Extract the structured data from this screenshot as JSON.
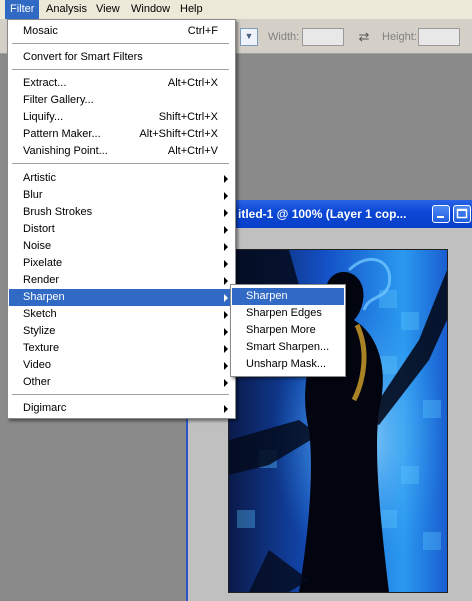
{
  "menubar": {
    "items": [
      {
        "label": "Filter"
      },
      {
        "label": "Analysis"
      },
      {
        "label": "View"
      },
      {
        "label": "Window"
      },
      {
        "label": "Help"
      }
    ]
  },
  "options_bar": {
    "width_label": "Width:",
    "height_label": "Height:",
    "width_value": "",
    "height_value": ""
  },
  "document": {
    "title": "itled-1 @ 100% (Layer 1 cop..."
  },
  "filter_menu": {
    "top_items": [
      {
        "label": "Mosaic",
        "shortcut": "Ctrl+F"
      },
      {
        "label": "Convert for Smart Filters",
        "shortcut": ""
      }
    ],
    "mid_items": [
      {
        "label": "Extract...",
        "shortcut": "Alt+Ctrl+X"
      },
      {
        "label": "Filter Gallery...",
        "shortcut": ""
      },
      {
        "label": "Liquify...",
        "shortcut": "Shift+Ctrl+X"
      },
      {
        "label": "Pattern Maker...",
        "shortcut": "Alt+Shift+Ctrl+X"
      },
      {
        "label": "Vanishing Point...",
        "shortcut": "Alt+Ctrl+V"
      }
    ],
    "submenus": [
      {
        "label": "Artistic"
      },
      {
        "label": "Blur"
      },
      {
        "label": "Brush Strokes"
      },
      {
        "label": "Distort"
      },
      {
        "label": "Noise"
      },
      {
        "label": "Pixelate"
      },
      {
        "label": "Render"
      },
      {
        "label": "Sharpen"
      },
      {
        "label": "Sketch"
      },
      {
        "label": "Stylize"
      },
      {
        "label": "Texture"
      },
      {
        "label": "Video"
      },
      {
        "label": "Other"
      }
    ],
    "bottom_items": [
      {
        "label": "Digimarc"
      }
    ]
  },
  "sharpen_submenu": {
    "items": [
      {
        "label": "Sharpen"
      },
      {
        "label": "Sharpen Edges"
      },
      {
        "label": "Sharpen More"
      },
      {
        "label": "Smart Sharpen..."
      },
      {
        "label": "Unsharp Mask..."
      }
    ]
  },
  "colors": {
    "highlight": "#316ac5",
    "menu_background": "#ffffff",
    "titlebar": "#0a46d5"
  }
}
